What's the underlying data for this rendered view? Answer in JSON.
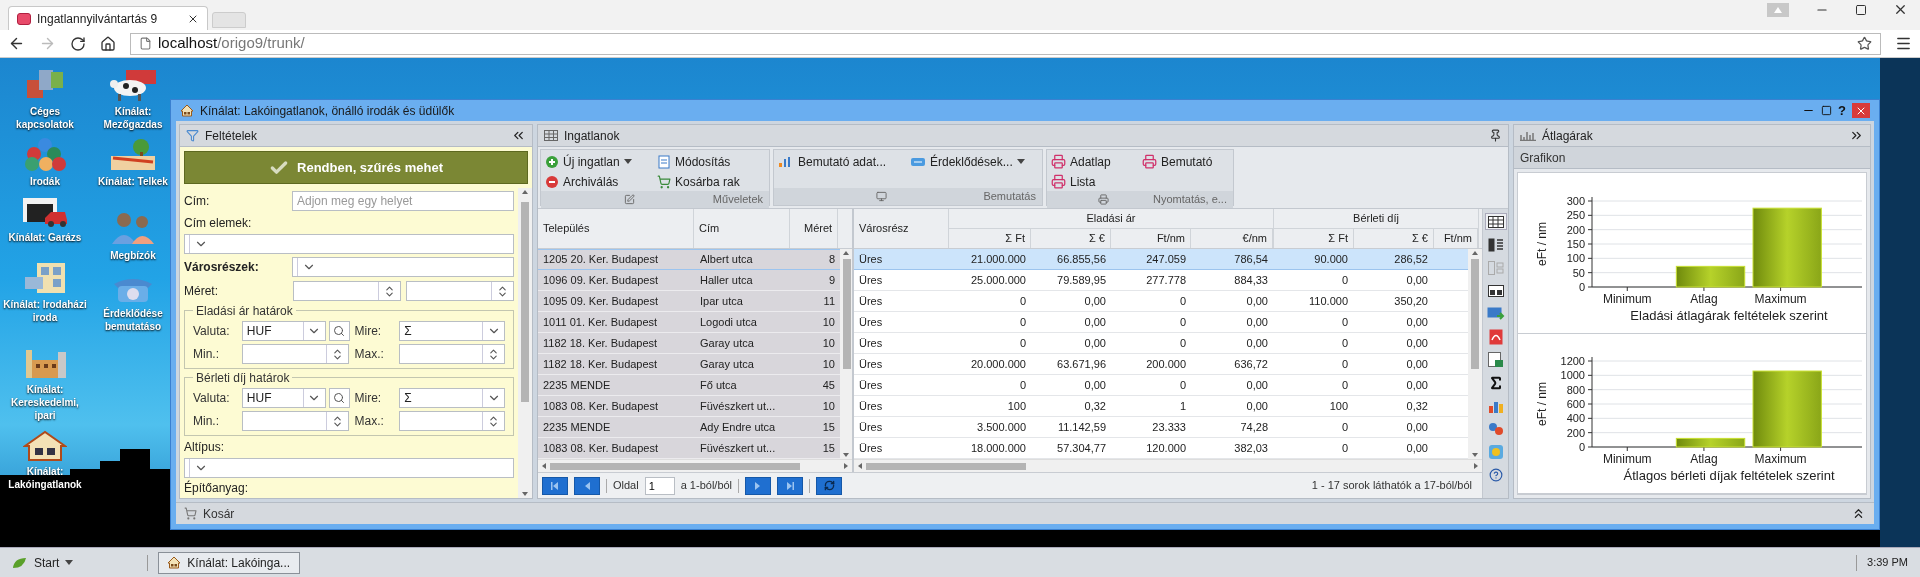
{
  "browser": {
    "tab_title": "Ingatlannyilvántartás 9",
    "url_host": "localhost",
    "url_path": "/origo9/trunk/"
  },
  "desktop_icons": [
    {
      "label": "Céges kapcsolatok"
    },
    {
      "label": "Irodák"
    },
    {
      "label": "Kínálat: Garázs"
    },
    {
      "label": "Kínálat: Irodaházi iroda"
    },
    {
      "label": "Kínálat: Kereskedelmi, ipari"
    },
    {
      "label": "Kínálat: Lakóingatlanok"
    },
    {
      "label": "Kínálat: Mezőgazdas"
    },
    {
      "label": "Kínálat: Telkek"
    },
    {
      "label": "Megbízók"
    },
    {
      "label": "Érdeklődése bemutatáso"
    }
  ],
  "window": {
    "title": "Kínálat: Lakóingatlanok, önálló irodák és üdülők",
    "help_button": "?"
  },
  "filter_panel": {
    "title": "Feltételek",
    "apply_button": "Rendben, szűrés mehet",
    "fields": [
      {
        "kind": "text",
        "label": "Cím:",
        "placeholder": "Adjon meg egy helyet",
        "bold": false
      },
      {
        "kind": "dropdown_below",
        "label": "Cím elemek:",
        "bold": false
      },
      {
        "kind": "dropdown",
        "label": "Városrészek:",
        "bold": true
      },
      {
        "kind": "range",
        "label": "Méret:",
        "bold": false
      },
      {
        "kind": "group",
        "title": "Eladási ár határok",
        "bold": false,
        "currency_label": "Valuta:",
        "currency": "HUF",
        "target_label": "Mire:",
        "target": "Σ",
        "min_label": "Min.:",
        "max_label": "Max.:"
      },
      {
        "kind": "group",
        "title": "Bérleti díj határok",
        "bold": false,
        "currency_label": "Valuta:",
        "currency": "HUF",
        "target_label": "Mire:",
        "target": "Σ",
        "min_label": "Min.:",
        "max_label": "Max.:"
      },
      {
        "kind": "dropdown_below",
        "label": "Altípus:",
        "bold": false
      },
      {
        "kind": "label",
        "label": "Építőanyag:",
        "bold": false
      }
    ]
  },
  "list_panel": {
    "title": "Ingatlanok",
    "toolbar_groups": [
      {
        "caption": "Műveletek",
        "buttons": [
          {
            "label": "Új ingatlan",
            "dropdown": true
          },
          {
            "label": "Módosítás",
            "dropdown": false
          },
          {
            "label": "Archiválás",
            "dropdown": false
          },
          {
            "label": "Kosárba rak",
            "dropdown": false
          }
        ]
      },
      {
        "caption": "Bemutatás",
        "buttons": [
          {
            "label": "Bemutató adat...",
            "dropdown": false
          },
          {
            "label": "Érdeklődések...",
            "dropdown": true
          }
        ]
      },
      {
        "caption": "Nyomtatás, e...",
        "buttons": [
          {
            "label": "Adatlap",
            "dropdown": false
          },
          {
            "label": "Bemutató",
            "dropdown": false
          },
          {
            "label": "Lista",
            "dropdown": false
          }
        ]
      }
    ],
    "table": {
      "columns": [
        "Település",
        "Cím",
        "Méret",
        "Városrész"
      ],
      "column_groups": [
        {
          "label": "Eladási ár",
          "columns": [
            "Σ Ft",
            "Σ €",
            "Ft/nm",
            "€/nm"
          ]
        },
        {
          "label": "Bérleti díj",
          "columns": [
            "Σ Ft",
            "Σ €",
            "Ft/nm"
          ]
        }
      ],
      "rows": [
        {
          "selected": true,
          "cells": [
            "1205 20. Ker. Budapest",
            "Albert utca",
            "8",
            "Üres",
            "21.000.000",
            "66.855,56",
            "247.059",
            "786,54",
            "90.000",
            "286,52"
          ]
        },
        {
          "selected": false,
          "cells": [
            "1096 09. Ker. Budapest",
            "Haller utca",
            "9",
            "Üres",
            "25.000.000",
            "79.589,95",
            "277.778",
            "884,33",
            "0",
            "0,00"
          ]
        },
        {
          "selected": false,
          "cells": [
            "1095 09. Ker. Budapest",
            "Ipar utca",
            "11",
            "Üres",
            "0",
            "0,00",
            "0",
            "0,00",
            "110.000",
            "350,20"
          ]
        },
        {
          "selected": false,
          "cells": [
            "1011 01. Ker. Budapest",
            "Logodi utca",
            "10",
            "Üres",
            "0",
            "0,00",
            "0",
            "0,00",
            "0",
            "0,00"
          ]
        },
        {
          "selected": false,
          "cells": [
            "1182 18. Ker. Budapest",
            "Garay utca",
            "10",
            "Üres",
            "0",
            "0,00",
            "0",
            "0,00",
            "0",
            "0,00"
          ]
        },
        {
          "selected": false,
          "cells": [
            "1182 18. Ker. Budapest",
            "Garay utca",
            "10",
            "Üres",
            "20.000.000",
            "63.671,96",
            "200.000",
            "636,72",
            "0",
            "0,00"
          ]
        },
        {
          "selected": false,
          "cells": [
            "2235 MENDE",
            "Fő utca",
            "45",
            "Üres",
            "0",
            "0,00",
            "0",
            "0,00",
            "0",
            "0,00"
          ]
        },
        {
          "selected": false,
          "cells": [
            "1083 08. Ker. Budapest",
            "Füvészkert ut...",
            "10",
            "Üres",
            "100",
            "0,32",
            "1",
            "0,00",
            "100",
            "0,32"
          ]
        },
        {
          "selected": false,
          "cells": [
            "2235 MENDE",
            "Ady Endre utca",
            "15",
            "Üres",
            "3.500.000",
            "11.142,59",
            "23.333",
            "74,28",
            "0",
            "0,00"
          ]
        },
        {
          "selected": false,
          "cells": [
            "1083 08. Ker. Budapest",
            "Füvészkert ut...",
            "15",
            "Üres",
            "18.000.000",
            "57.304,77",
            "120.000",
            "382,03",
            "0",
            "0,00"
          ]
        }
      ]
    },
    "pager": {
      "page_label": "Oldal",
      "page": "1",
      "page_of": "a 1-ból/ból",
      "summary": "1 - 17 sorok láthatók a 17-ból/ból"
    }
  },
  "chart_panel": {
    "title": "Átlagárak",
    "section": "Grafikon",
    "charts": [
      {
        "chart_data": {
          "type": "bar",
          "xlabel": "Eladási átlagárak feltételek szerint",
          "ylabel": "eFt / nm",
          "categories": [
            "Minimum",
            "Atlag",
            "Maximum"
          ],
          "values": [
            0,
            72,
            275
          ],
          "ylim": [
            0,
            300
          ],
          "grid": true,
          "yticks": [
            0,
            50,
            100,
            150,
            200,
            250,
            300
          ]
        }
      },
      {
        "chart_data": {
          "type": "bar",
          "xlabel": "Átlagos bérleti díjak feltételek szerint",
          "ylabel": "eFt / nm",
          "categories": [
            "Minimum",
            "Atlag",
            "Maximum"
          ],
          "values": [
            0,
            120,
            1060
          ],
          "ylim": [
            0,
            1200
          ],
          "grid": true,
          "yticks": [
            0,
            200,
            400,
            600,
            800,
            1000,
            1200
          ]
        }
      }
    ]
  },
  "basket": {
    "title": "Kosár"
  },
  "taskbar": {
    "start": "Start",
    "tasks": [
      {
        "label": "Kínálat: Lakóinga...",
        "selected": true
      }
    ],
    "clock": "3:39 PM"
  }
}
